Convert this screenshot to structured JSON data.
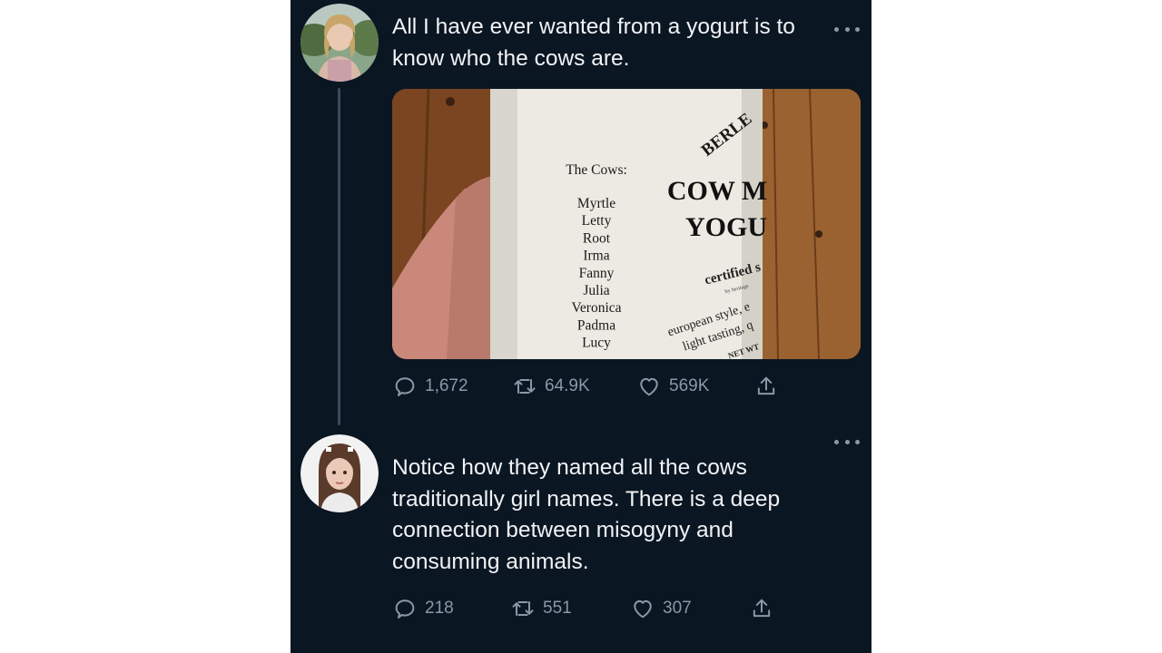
{
  "tweets": [
    {
      "text": "All I have ever wanted from a yogurt is to know who the cows are.",
      "media": {
        "label_heading": "The Cows:",
        "cow_names": [
          "Myrtle",
          "Letty",
          "Root",
          "Irma",
          "Fanny",
          "Julia",
          "Veronica",
          "Padma",
          "Lucy"
        ],
        "brand_text": "BERLE",
        "product_line1": "COW M",
        "product_line2": "YOGU",
        "certified_text": "certified s",
        "small_text": "by heritage",
        "desc_line1": "european style, e",
        "desc_line2": "light tasting, q",
        "net_text": "NET WT"
      },
      "actions": {
        "replies": "1,672",
        "retweets": "64.9K",
        "likes": "569K"
      }
    },
    {
      "text": "Notice how they named all the cows traditionally girl names. There is a deep connection between misogyny and consuming animals.",
      "actions": {
        "replies": "218",
        "retweets": "551",
        "likes": "307"
      }
    }
  ],
  "icons": {
    "reply": "speech-bubble-icon",
    "retweet": "retweet-arrows-icon",
    "like": "heart-icon",
    "share": "share-upload-icon",
    "more": "ellipsis-icon"
  },
  "colors": {
    "background": "#0b1623",
    "text": "#f1f3f4",
    "muted": "#8b98a5",
    "thread_line": "#3b4a5c"
  }
}
